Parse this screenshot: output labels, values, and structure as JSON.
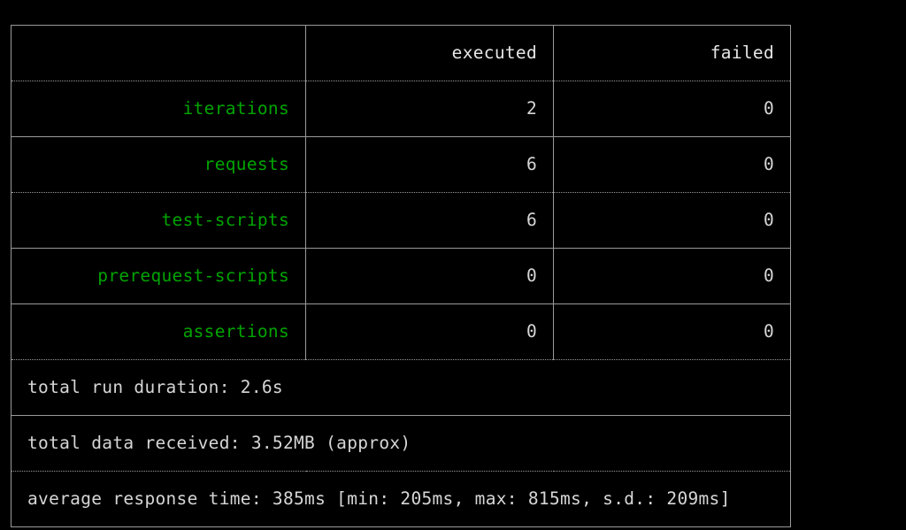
{
  "terminal": {
    "background": "#000000",
    "border_color": "#9a9a9a",
    "label_color": "#00a400",
    "value_color": "#d6d6d6"
  },
  "table": {
    "headers": {
      "blank": "",
      "executed": "executed",
      "failed": "failed"
    },
    "rows": [
      {
        "label": "iterations",
        "executed": "2",
        "failed": "0"
      },
      {
        "label": "requests",
        "executed": "6",
        "failed": "0"
      },
      {
        "label": "test-scripts",
        "executed": "6",
        "failed": "0"
      },
      {
        "label": "prerequest-scripts",
        "executed": "0",
        "failed": "0"
      },
      {
        "label": "assertions",
        "executed": "0",
        "failed": "0"
      }
    ],
    "footers": [
      {
        "text": "total run duration: 2.6s"
      },
      {
        "text": "total data received: 3.52MB (approx)"
      },
      {
        "text": "average response time: 385ms [min: 205ms, max: 815ms, s.d.: 209ms]"
      }
    ]
  }
}
